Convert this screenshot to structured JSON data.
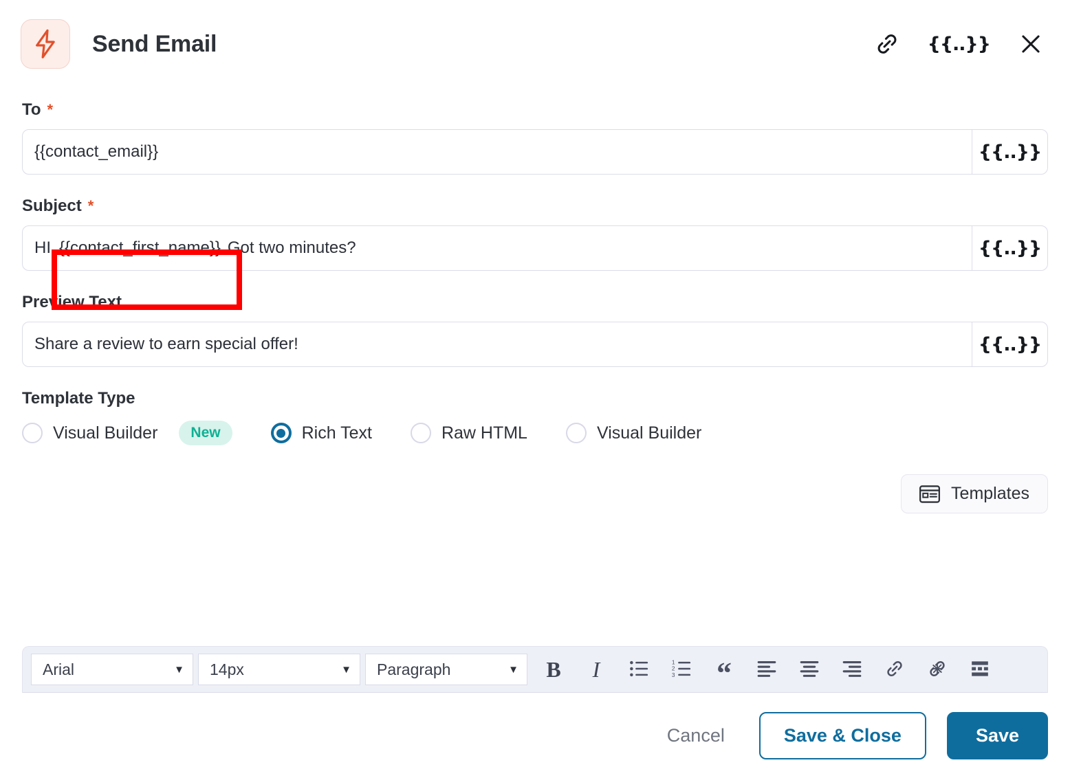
{
  "header": {
    "title": "Send Email",
    "icon": "lightning-bolt-icon",
    "actions": {
      "link_label": "link-icon",
      "merge_tag_label": "{{..}}",
      "close_label": "close-icon"
    }
  },
  "form": {
    "to": {
      "label": "To",
      "required_marker": "*",
      "value": "{{contact_email}}",
      "merge_button_label": "{{..}}"
    },
    "subject": {
      "label": "Subject",
      "required_marker": "*",
      "value_prefix": "HI",
      "value_tag": "{{contact_first_name}}",
      "value_suffix": "Got two minutes?",
      "merge_button_label": "{{..}}"
    },
    "preview_text": {
      "label": "Preview Text",
      "value": "Share a review to earn special offer!",
      "merge_button_label": "{{..}}"
    },
    "template_type": {
      "label": "Template Type",
      "options": [
        {
          "label": "Visual Builder",
          "selected": false,
          "badge": "New"
        },
        {
          "label": "Rich Text",
          "selected": true,
          "badge": ""
        },
        {
          "label": "Raw HTML",
          "selected": false,
          "badge": ""
        },
        {
          "label": "Visual Builder",
          "selected": false,
          "badge": ""
        }
      ]
    }
  },
  "templates_button": {
    "label": "Templates",
    "icon": "template-layout-icon"
  },
  "editor_toolbar": {
    "font_family": "Arial",
    "font_size": "14px",
    "block_format": "Paragraph",
    "caret": "▼",
    "buttons": [
      {
        "name": "bold-button",
        "glyph": "B"
      },
      {
        "name": "italic-button",
        "glyph": "I"
      },
      {
        "name": "bulleted-list-button",
        "glyph": "bullet-list-icon"
      },
      {
        "name": "numbered-list-button",
        "glyph": "numbered-list-icon"
      },
      {
        "name": "blockquote-button",
        "glyph": "“"
      },
      {
        "name": "align-left-button",
        "glyph": "align-left-icon"
      },
      {
        "name": "align-center-button",
        "glyph": "align-center-icon"
      },
      {
        "name": "align-right-button",
        "glyph": "align-right-icon"
      },
      {
        "name": "insert-link-button",
        "glyph": "link-icon"
      },
      {
        "name": "unlink-button",
        "glyph": "unlink-icon"
      },
      {
        "name": "horizontal-rule-button",
        "glyph": "horizontal-rule-icon"
      }
    ]
  },
  "footer": {
    "cancel_label": "Cancel",
    "save_close_label": "Save & Close",
    "save_label": "Save"
  },
  "colors": {
    "accent_blue": "#0f6d9e",
    "required_orange": "#e2502b",
    "badge_teal": "#10b094",
    "badge_bg": "#d7f3ec",
    "annotation_red": "#ff0000",
    "toolbar_bg": "#eef0f7"
  }
}
